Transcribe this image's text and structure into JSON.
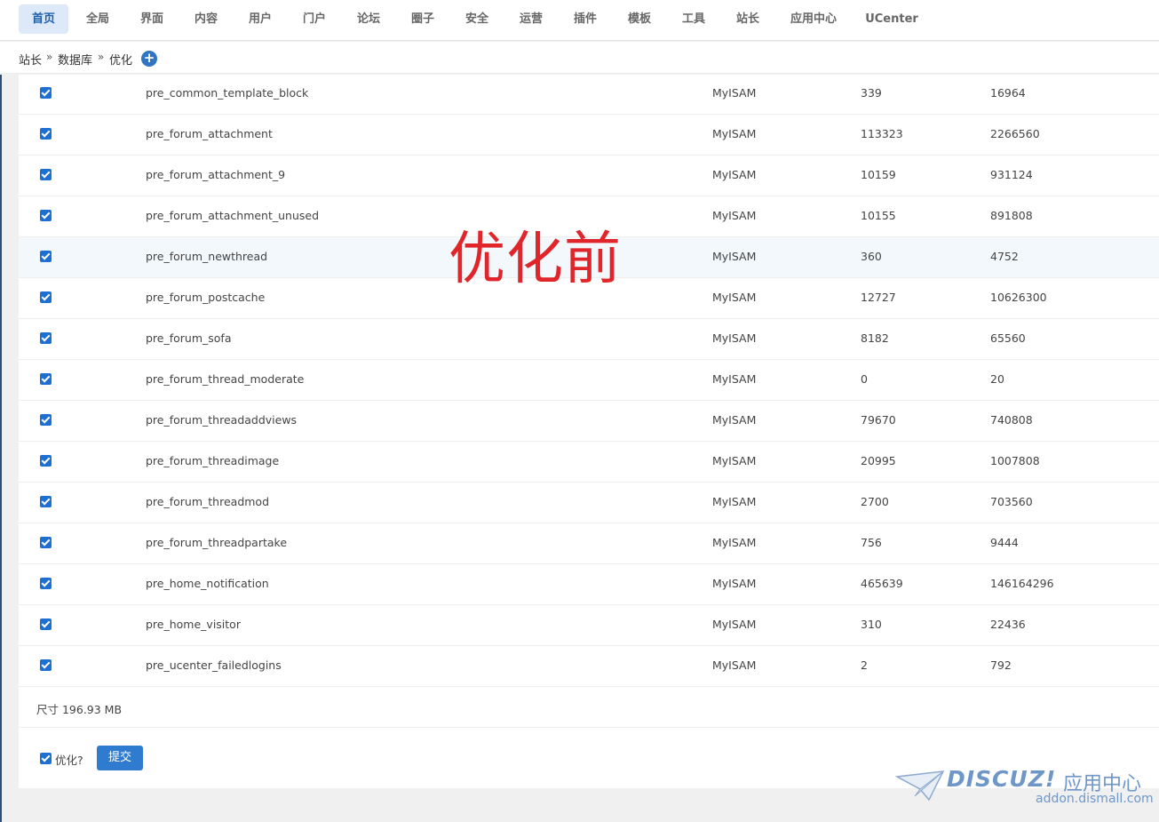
{
  "nav": {
    "tabs": [
      {
        "label": "首页",
        "active": true
      },
      {
        "label": "全局"
      },
      {
        "label": "界面"
      },
      {
        "label": "内容"
      },
      {
        "label": "用户"
      },
      {
        "label": "门户"
      },
      {
        "label": "论坛"
      },
      {
        "label": "圈子"
      },
      {
        "label": "安全"
      },
      {
        "label": "运营"
      },
      {
        "label": "插件"
      },
      {
        "label": "模板"
      },
      {
        "label": "工具"
      },
      {
        "label": "站长"
      },
      {
        "label": "应用中心"
      },
      {
        "label": "UCenter"
      }
    ]
  },
  "breadcrumb": {
    "items": [
      "站长",
      "数据库",
      "优化"
    ],
    "separator": "»",
    "add_icon": "plus-circle-icon"
  },
  "table": {
    "rows": [
      {
        "checked": true,
        "name": "pre_common_template_block",
        "engine": "MyISAM",
        "rows": "339",
        "data": "16964"
      },
      {
        "checked": true,
        "name": "pre_forum_attachment",
        "engine": "MyISAM",
        "rows": "113323",
        "data": "2266560"
      },
      {
        "checked": true,
        "name": "pre_forum_attachment_9",
        "engine": "MyISAM",
        "rows": "10159",
        "data": "931124"
      },
      {
        "checked": true,
        "name": "pre_forum_attachment_unused",
        "engine": "MyISAM",
        "rows": "10155",
        "data": "891808"
      },
      {
        "checked": true,
        "name": "pre_forum_newthread",
        "engine": "MyISAM",
        "rows": "360",
        "data": "4752",
        "highlight": true
      },
      {
        "checked": true,
        "name": "pre_forum_postcache",
        "engine": "MyISAM",
        "rows": "12727",
        "data": "10626300"
      },
      {
        "checked": true,
        "name": "pre_forum_sofa",
        "engine": "MyISAM",
        "rows": "8182",
        "data": "65560"
      },
      {
        "checked": true,
        "name": "pre_forum_thread_moderate",
        "engine": "MyISAM",
        "rows": "0",
        "data": "20"
      },
      {
        "checked": true,
        "name": "pre_forum_threadaddviews",
        "engine": "MyISAM",
        "rows": "79670",
        "data": "740808"
      },
      {
        "checked": true,
        "name": "pre_forum_threadimage",
        "engine": "MyISAM",
        "rows": "20995",
        "data": "1007808"
      },
      {
        "checked": true,
        "name": "pre_forum_threadmod",
        "engine": "MyISAM",
        "rows": "2700",
        "data": "703560"
      },
      {
        "checked": true,
        "name": "pre_forum_threadpartake",
        "engine": "MyISAM",
        "rows": "756",
        "data": "9444"
      },
      {
        "checked": true,
        "name": "pre_home_notification",
        "engine": "MyISAM",
        "rows": "465639",
        "data": "146164296"
      },
      {
        "checked": true,
        "name": "pre_home_visitor",
        "engine": "MyISAM",
        "rows": "310",
        "data": "22436"
      },
      {
        "checked": true,
        "name": "pre_ucenter_failedlogins",
        "engine": "MyISAM",
        "rows": "2",
        "data": "792"
      }
    ]
  },
  "size_text": "尺寸 196.93 MB",
  "optimize": {
    "checked": true,
    "label": "优化?",
    "submit_label": "提交"
  },
  "overlay_text": "优化前",
  "watermark": {
    "brand": "DISCUZ!",
    "brand_cn": "应用中心",
    "url": "addon.dismall.com"
  },
  "colors": {
    "accent": "#2e7bcf",
    "checkbox": "#1d6fd1",
    "overlay": "#e0262a",
    "watermark": "#6f96c8"
  }
}
